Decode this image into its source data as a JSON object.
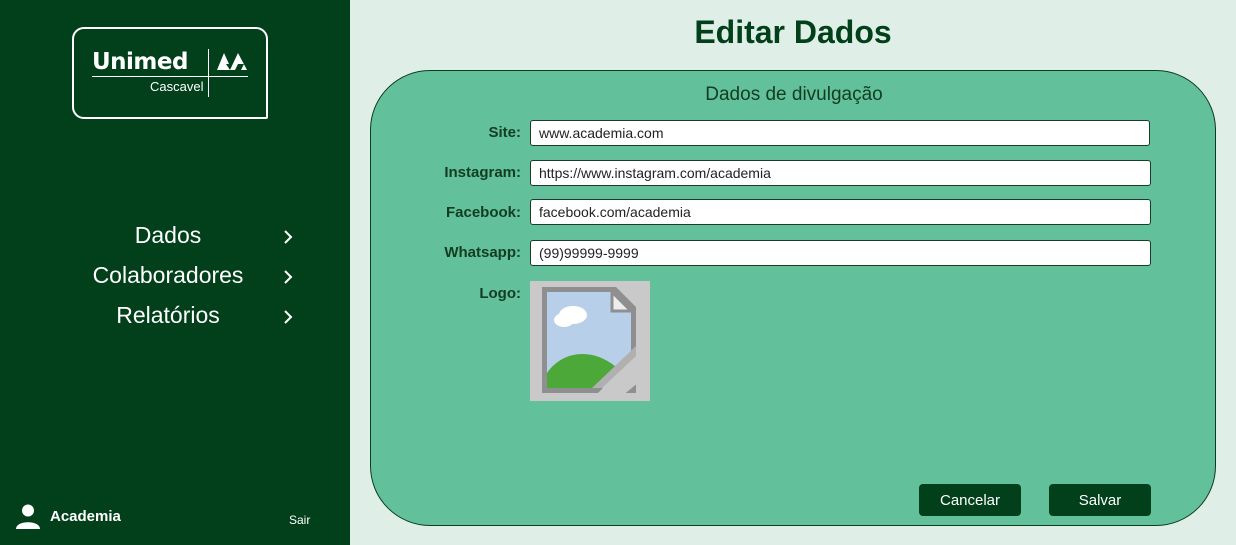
{
  "sidebar": {
    "logo": {
      "brand": "Unimed",
      "city": "Cascavel"
    },
    "nav": [
      {
        "label": "Dados"
      },
      {
        "label": "Colaboradores"
      },
      {
        "label": "Relatórios"
      }
    ],
    "user": {
      "name": "Academia",
      "logout_label": "Sair"
    }
  },
  "main": {
    "title": "Editar Dados",
    "section_title": "Dados de divulgação",
    "fields": {
      "site": {
        "label": "Site:",
        "value": "www.academia.com"
      },
      "instagram": {
        "label": "Instagram:",
        "value": "https://www.instagram.com/academia"
      },
      "facebook": {
        "label": "Facebook:",
        "value": "facebook.com/academia"
      },
      "whatsapp": {
        "label": "Whatsapp:",
        "value": "(99)99999-9999"
      }
    },
    "logo_label": "Logo:",
    "buttons": {
      "cancel": "Cancelar",
      "save": "Salvar"
    }
  },
  "colors": {
    "sidebar_bg": "#01401b",
    "page_bg": "#dfeee6",
    "card_bg": "#62c09a",
    "button_bg": "#01401b"
  },
  "icons": {
    "nav_chevron": "chevron-right-icon",
    "user": "user-icon",
    "logo_placeholder": "broken-image-icon"
  }
}
